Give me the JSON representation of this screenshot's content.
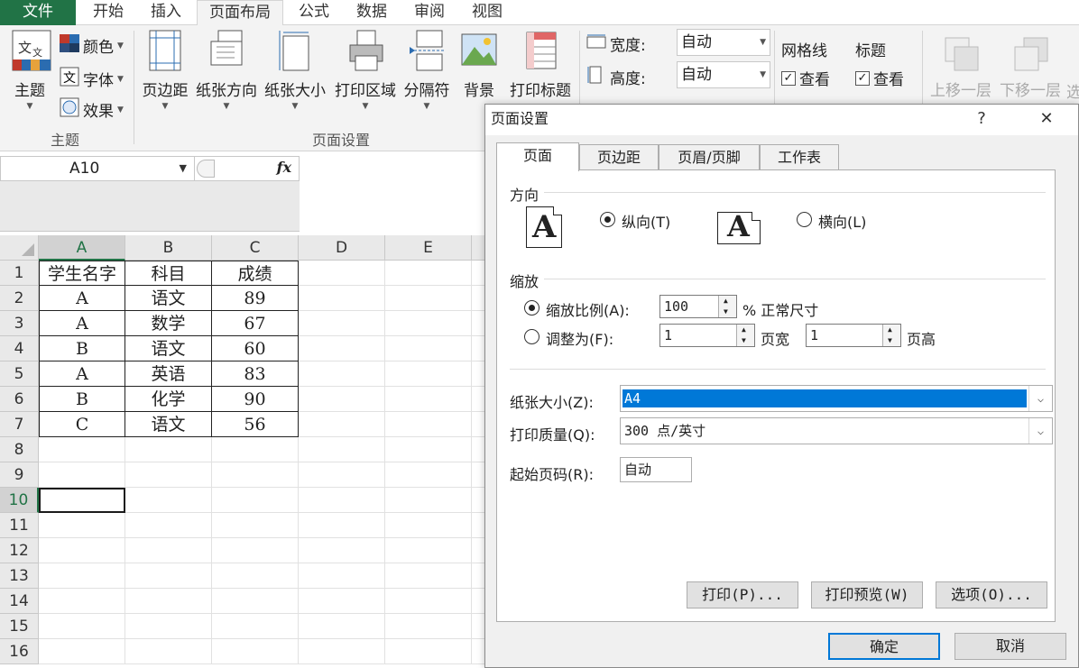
{
  "ribbon_tabs": [
    "文件",
    "开始",
    "插入",
    "页面布局",
    "公式",
    "数据",
    "审阅",
    "视图"
  ],
  "ribbon": {
    "theme": {
      "themes_label": "主题",
      "colors_label": "颜色",
      "fonts_label": "字体",
      "effects_label": "效果",
      "group_label": "主题"
    },
    "page_setup": {
      "margins_label": "页边距",
      "orientation_label": "纸张方向",
      "size_label": "纸张大小",
      "print_area_label": "打印区域",
      "breaks_label": "分隔符",
      "background_label": "背景",
      "print_titles_label": "打印标题",
      "group_label": "页面设置"
    },
    "scale": {
      "width_label": "宽度:",
      "width_value": "自动",
      "height_label": "高度:",
      "height_value": "自动"
    },
    "sheet_options": {
      "gridlines_label": "网格线",
      "gridlines_view": "查看",
      "headings_label": "标题",
      "headings_view": "查看"
    },
    "arrange": {
      "bring_forward_label": "上移一层",
      "send_backward_label": "下移一层",
      "select_pane_label": "选"
    }
  },
  "formula_bar": {
    "name_box": "A10",
    "fx_label": "fx"
  },
  "sheet": {
    "columns": [
      "A",
      "B",
      "C",
      "D",
      "E"
    ],
    "rows": [
      "1",
      "2",
      "3",
      "4",
      "5",
      "6",
      "7",
      "8",
      "9",
      "10",
      "11",
      "12",
      "13",
      "14",
      "15",
      "16"
    ],
    "data": [
      [
        "学生名字",
        "科目",
        "成绩"
      ],
      [
        "A",
        "语文",
        "89"
      ],
      [
        "A",
        "数学",
        "67"
      ],
      [
        "B",
        "语文",
        "60"
      ],
      [
        "A",
        "英语",
        "83"
      ],
      [
        "B",
        "化学",
        "90"
      ],
      [
        "C",
        "语文",
        "56"
      ]
    ]
  },
  "dialog": {
    "title": "页面设置",
    "help_glyph": "?",
    "close_glyph": "✕",
    "tabs": [
      "页面",
      "页边距",
      "页眉/页脚",
      "工作表"
    ],
    "orientation_section": "方向",
    "portrait_label": "纵向(T)",
    "landscape_label": "横向(L)",
    "page_glyph": "A",
    "scaling_section": "缩放",
    "adjust_to_label": "缩放比例(A):",
    "adjust_value": "100",
    "percent_label": "% 正常尺寸",
    "fit_to_label": "调整为(F):",
    "fit_wide_value": "1",
    "fit_wide_label": "页宽",
    "fit_tall_value": "1",
    "fit_tall_label": "页高",
    "paper_size_label": "纸张大小(Z):",
    "paper_size_value": "A4",
    "print_quality_label": "打印质量(Q):",
    "print_quality_value": "300 点/英寸",
    "first_page_label": "起始页码(R):",
    "first_page_value": "自动",
    "print_button": "打印(P)...",
    "preview_button": "打印预览(W)",
    "options_button": "选项(O)...",
    "ok_button": "确定",
    "cancel_button": "取消"
  }
}
